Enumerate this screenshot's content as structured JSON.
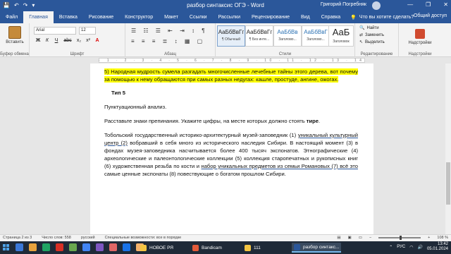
{
  "window": {
    "title": "разбор синтаксис ОГЭ  -  Word",
    "user": "Григорий Погребняк",
    "controls": [
      "—",
      "❐",
      "✕"
    ]
  },
  "quick_access": [
    "💾",
    "↶",
    "↷",
    "▾"
  ],
  "tabs": [
    "Файл",
    "Главная",
    "Вставка",
    "Рисование",
    "Конструктор",
    "Макет",
    "Ссылки",
    "Рассылки",
    "Рецензирование",
    "Вид",
    "Справка"
  ],
  "tell_me": "Что вы хотите сделать?",
  "share": "Общий доступ",
  "ribbon": {
    "clipboard": {
      "paste": "Вставить",
      "label": "Буфер обмена"
    },
    "font": {
      "name": "Arial",
      "size": "12",
      "buttons": [
        "Ж",
        "К",
        "Ч",
        "abc",
        "x₂",
        "x²"
      ],
      "label": "Шрифт"
    },
    "paragraph": {
      "label": "Абзац"
    },
    "styles": {
      "label": "Стили",
      "items": [
        {
          "sample": "АаБбВвГг",
          "name": "¶ Обычный"
        },
        {
          "sample": "АаБбВвГг",
          "name": "¶ Без инте..."
        },
        {
          "sample": "АаБбВв",
          "name": "Заголово..."
        },
        {
          "sample": "АаБбВвГ",
          "name": "Заголово..."
        },
        {
          "sample": "АаБ",
          "name": "Заголовок"
        }
      ]
    },
    "editing": {
      "find": "Найти",
      "replace": "Заменить",
      "select": "Выделить",
      "label": "Редактирование"
    },
    "addins": {
      "button": "Надстройки",
      "label": "Надстройки"
    }
  },
  "ruler_ticks": "· 1 · 2 · 3 · 4 · 5 · 6 · 7 · 8 · 9 · 10 · 11 · 12 · 13 · 14 · 15 · 16 · 17",
  "document": {
    "highlighted": "5)  Народная мудрость сумела разгадать многочисленные лечебные тайны этого дерева, вот почему за помощью к нему обращаются при самых разных недугах: кашле, простуде, ангине, ожогах.",
    "type_heading": "Тип 5",
    "analysis": "Пунктуационный анализ.",
    "instruction_prefix": "Расставьте знаки препинания. Укажите цифры, на месте которых должно стоять ",
    "instruction_bold": "тире",
    "instruction_suffix": ".",
    "p1": "Тобольский государственный историко-архитектурный музей-заповедник (1) ",
    "p1_ul": "уникальный культурный центр (2)",
    "p2": " вобравший в себя много из исторического наследия Сибири. В настоящий момент (3) в фондах музея-заповедника насчитывается более 400 тысяч экспонатов. Этнографические (4) археологические и палеонтологические коллекции (5) коллекция старопечатных и рукописных книг (6) художественная резьба по кости и ",
    "p2_ul": "набор уникальных предметов из семьи Романовых (7) всё это",
    "p3": " самые ценные экспонаты (8) повествующие о богатом прошлом Сибири."
  },
  "status": {
    "page": "Страница 2 из 3",
    "words": "Число слов: 558",
    "lang": "русский",
    "accessibility": "Специальные возможности: все в порядке",
    "zoom": "108 %"
  },
  "taskbar": {
    "apps": [
      {
        "label": "НОВОЕ РЯ",
        "color": "#f4c542"
      },
      {
        "label": "Bandicam",
        "color": "#e35b3a"
      },
      {
        "label": "111",
        "color": "#f4c542"
      },
      {
        "label": "разбор синтакс...",
        "color": "#2b579a"
      }
    ],
    "pinned_colors": [
      "#3b78d8",
      "#e8a33d",
      "#1fa463",
      "#d93025",
      "#6aa84f",
      "#4285f4",
      "#7e57c2",
      "#e06666",
      "#1a73e8",
      "#f6b26b"
    ],
    "tray_lang": "РУС",
    "time": "13:42",
    "date": "05.01.2024"
  },
  "colors": {
    "brand": "#2b579a",
    "highlight": "#ffff00"
  }
}
